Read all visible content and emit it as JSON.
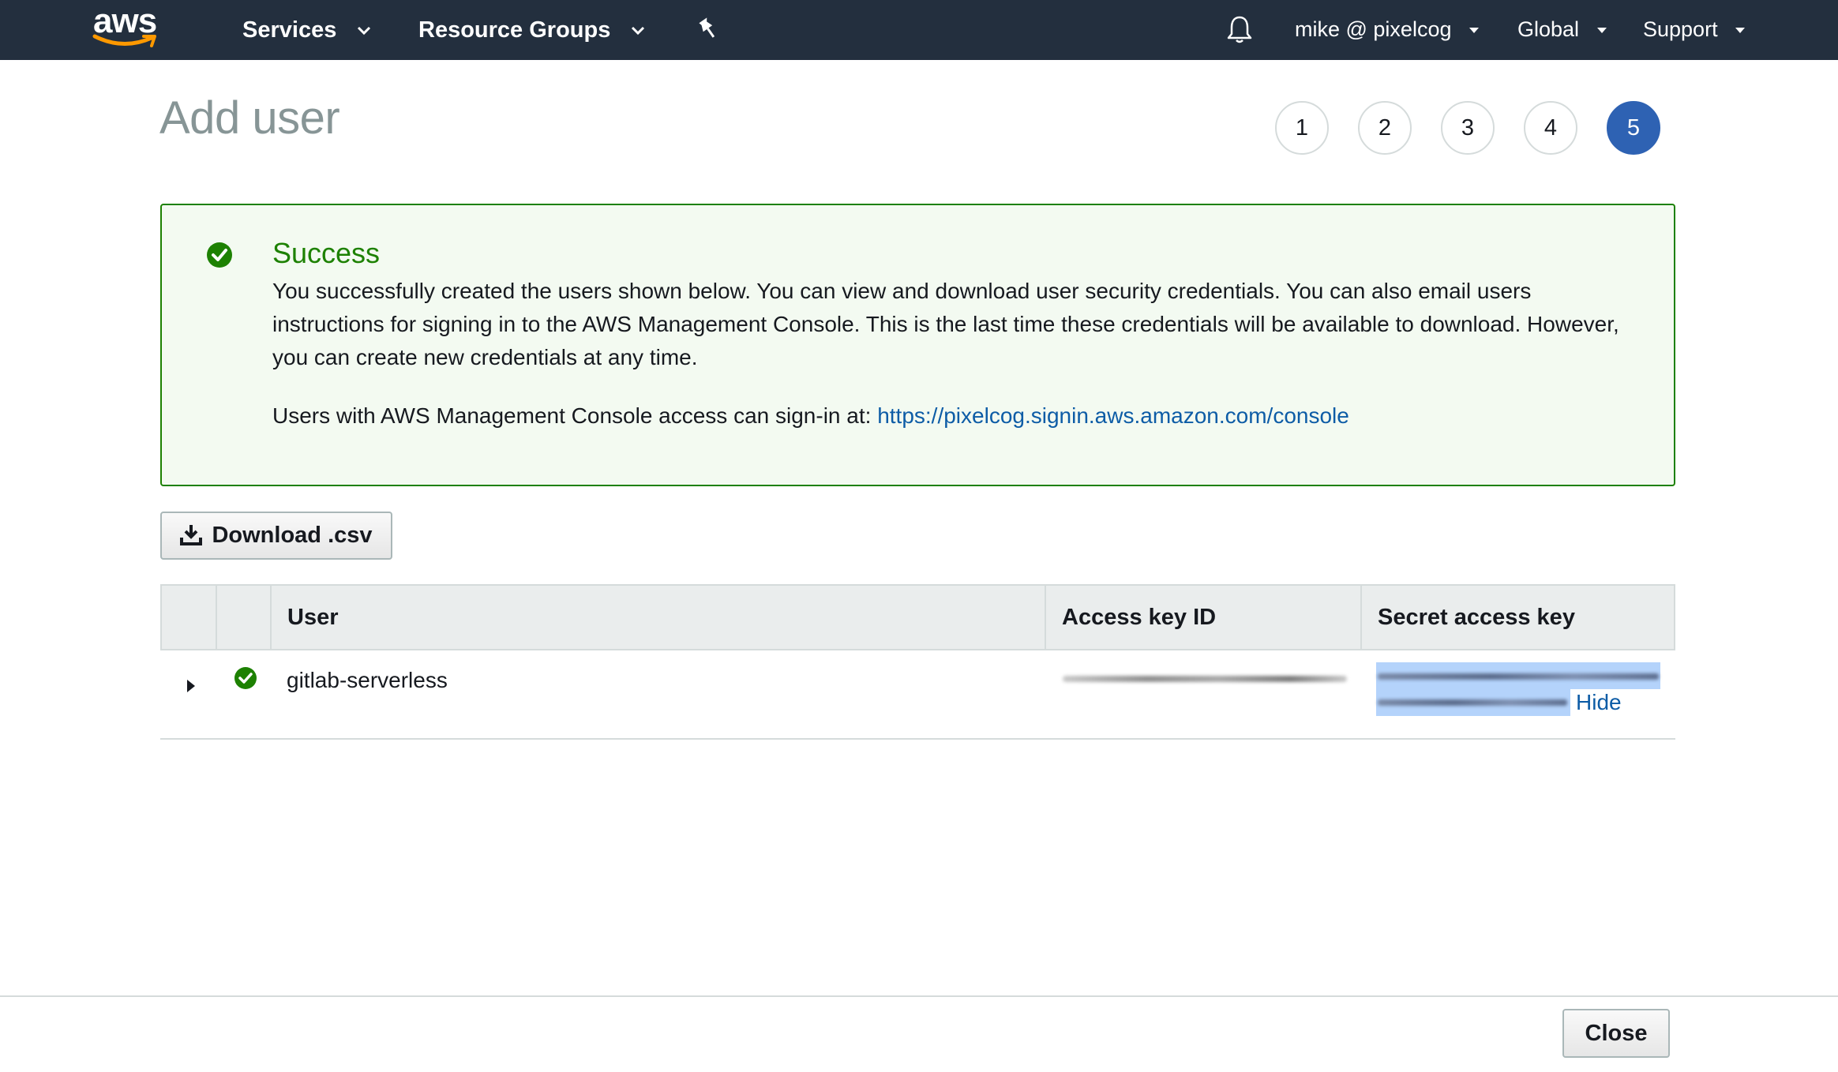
{
  "nav": {
    "logo_text": "aws",
    "services_label": "Services",
    "resource_groups_label": "Resource Groups",
    "account_label": "mike @ pixelcog",
    "region_label": "Global",
    "support_label": "Support",
    "icons": [
      "pin-icon",
      "bell-icon",
      "chevron-down-icon"
    ]
  },
  "page": {
    "title": "Add user",
    "steps": [
      "1",
      "2",
      "3",
      "4",
      "5"
    ],
    "active_step": "5"
  },
  "alert": {
    "title": "Success",
    "body": "You successfully created the users shown below. You can view and download user security credentials. You can also email users instructions for signing in to the AWS Management Console. This is the last time these credentials will be available to download. However, you can create new credentials at any time.",
    "signin_prefix": "Users with AWS Management Console access can sign-in at: ",
    "signin_url": "https://pixelcog.signin.aws.amazon.com/console",
    "color": "#1d8102"
  },
  "actions": {
    "download_label": "Download .csv",
    "close_label": "Close"
  },
  "table": {
    "columns": [
      "User",
      "Access key ID",
      "Secret access key"
    ],
    "rows": [
      {
        "user": "gitlab-serverless",
        "status": "success",
        "hide_label": "Hide"
      }
    ]
  },
  "colors": {
    "nav_bg": "#232f3e",
    "accent": "#2e62b3",
    "link": "#0d5ca6",
    "success": "#1d8102",
    "logo_smile": "#ff9900"
  }
}
